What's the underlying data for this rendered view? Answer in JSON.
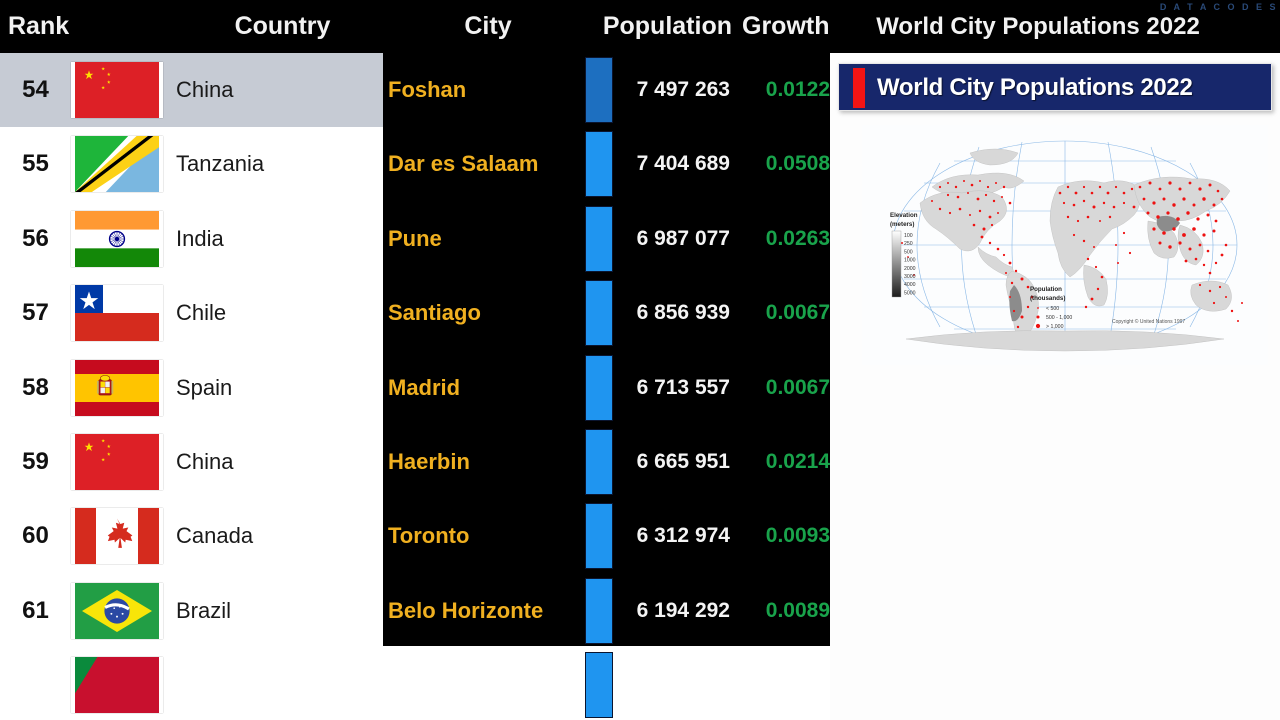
{
  "watermark": "D A T A   C O D E S",
  "header": {
    "rank": "Rank",
    "country": "Country",
    "city": "City",
    "population": "Population",
    "growth": "Growth",
    "title": "World City Populations 2022"
  },
  "banner": {
    "text": "World City Populations 2022"
  },
  "colors": {
    "bar": "#1f95f0",
    "bar_leader": "#1d6fc0",
    "city_text": "#f0b020",
    "growth_text": "#19a34b",
    "highlight_row": "#c6cbd4",
    "panel_dark": "#000000",
    "banner_bg": "#17276b",
    "banner_stripe": "#f21414"
  },
  "map": {
    "elevation_title": "Elevation",
    "elevation_unit": "(meters)",
    "elevation_ticks": [
      "100",
      "250",
      "500",
      "1000",
      "2000",
      "3000",
      "4000",
      "5000"
    ],
    "population_title": "Population",
    "population_unit": "(thousands)",
    "population_classes": [
      "< 500",
      "500 - 1,000",
      "> 1,000"
    ],
    "copyright": "Copyright © United Nations 1997"
  },
  "chart_data": {
    "type": "bar",
    "title": "World City Populations 2022",
    "xlabel": "Population",
    "ylabel": "City",
    "columns": [
      "Rank",
      "Country",
      "City",
      "Population",
      "Growth"
    ],
    "categories": [
      "Foshan",
      "Dar es Salaam",
      "Pune",
      "Santiago",
      "Madrid",
      "Haerbin",
      "Toronto",
      "Belo Horizonte"
    ],
    "values": [
      7497263,
      7404689,
      6987077,
      6856939,
      6713557,
      6665951,
      6312974,
      6194292
    ],
    "rows": [
      {
        "rank": "54",
        "country": "China",
        "city": "Foshan",
        "population": "7 497 263",
        "growth": "0.0122",
        "flag": "cn",
        "highlighted": true,
        "leader": true
      },
      {
        "rank": "55",
        "country": "Tanzania",
        "city": "Dar es Salaam",
        "population": "7 404 689",
        "growth": "0.0508",
        "flag": "tz",
        "highlighted": false,
        "leader": false
      },
      {
        "rank": "56",
        "country": "India",
        "city": "Pune",
        "population": "6 987 077",
        "growth": "0.0263",
        "flag": "in",
        "highlighted": false,
        "leader": false
      },
      {
        "rank": "57",
        "country": "Chile",
        "city": "Santiago",
        "population": "6 856 939",
        "growth": "0.0067",
        "flag": "cl",
        "highlighted": false,
        "leader": false
      },
      {
        "rank": "58",
        "country": "Spain",
        "city": "Madrid",
        "population": "6 713 557",
        "growth": "0.0067",
        "flag": "es",
        "highlighted": false,
        "leader": false
      },
      {
        "rank": "59",
        "country": "China",
        "city": "Haerbin",
        "population": "6 665 951",
        "growth": "0.0214",
        "flag": "cn",
        "highlighted": false,
        "leader": false
      },
      {
        "rank": "60",
        "country": "Canada",
        "city": "Toronto",
        "population": "6 312 974",
        "growth": "0.0093",
        "flag": "ca",
        "highlighted": false,
        "leader": false
      },
      {
        "rank": "61",
        "country": "Brazil",
        "city": "Belo Horizonte",
        "population": "6 194 292",
        "growth": "0.0089",
        "flag": "br",
        "highlighted": false,
        "leader": false
      }
    ],
    "partial_row_next": {
      "flag": "partial-green-red"
    }
  }
}
